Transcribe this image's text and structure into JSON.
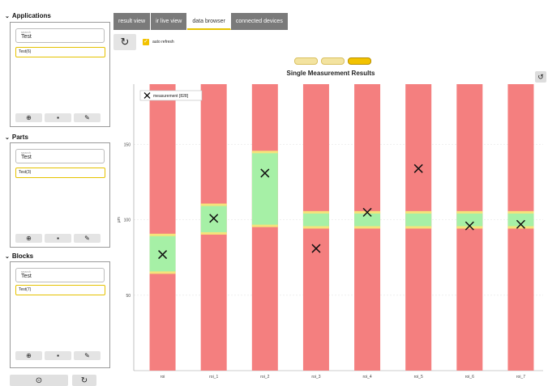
{
  "sidebar": {
    "applications": {
      "title": "Applications",
      "search_placeholder": "search",
      "search_value": "Test",
      "item": "Test(6)"
    },
    "parts": {
      "title": "Parts",
      "search_placeholder": "search",
      "search_value": "Test",
      "item": "Test(3)"
    },
    "blocks": {
      "title": "Blocks",
      "search_placeholder": "search",
      "search_value": "Test",
      "item": "Test(7)"
    },
    "icons": {
      "add": "add-circle-icon",
      "delete": "trash-icon",
      "edit": "pencil-icon"
    }
  },
  "tabs": [
    {
      "label": "result view",
      "active": false
    },
    {
      "label": "ir live view",
      "active": false
    },
    {
      "label": "data browser",
      "active": true
    },
    {
      "label": "connected devices",
      "active": false
    }
  ],
  "toolbar": {
    "auto_refresh_label": "auto refresh",
    "auto_refresh_checked": true
  },
  "pagination": {
    "pages": 3,
    "current": 3
  },
  "colors": {
    "accent": "#f2c200",
    "red_zone": "#f47f7f",
    "green_zone": "#a6f0a6",
    "yellow_band": "#f5e37a"
  },
  "chart_data": {
    "type": "bar",
    "title": "Single Measurement Results",
    "ylabel": "µm",
    "ylim": [
      0,
      190
    ],
    "yticks": [
      50,
      100,
      150
    ],
    "legend": {
      "label": "measurement [828]",
      "marker": "x",
      "placement": "top-left"
    },
    "categories": [
      "roi",
      "roi_1",
      "roi_2",
      "roi_3",
      "roi_4",
      "roi_5",
      "roi_6",
      "roi_7"
    ],
    "series": [
      {
        "name": "measurement [828]",
        "values": [
          77,
          101,
          131,
          81,
          105,
          134,
          96,
          97
        ]
      }
    ],
    "tolerance_bands": [
      {
        "low": 65,
        "high": 90
      },
      {
        "low": 91,
        "high": 110
      },
      {
        "low": 96,
        "high": 145
      },
      {
        "low": 95,
        "high": 105
      },
      {
        "low": 95,
        "high": 105
      },
      {
        "low": 95,
        "high": 105
      },
      {
        "low": 95,
        "high": 105
      },
      {
        "low": 95,
        "high": 105
      }
    ]
  }
}
